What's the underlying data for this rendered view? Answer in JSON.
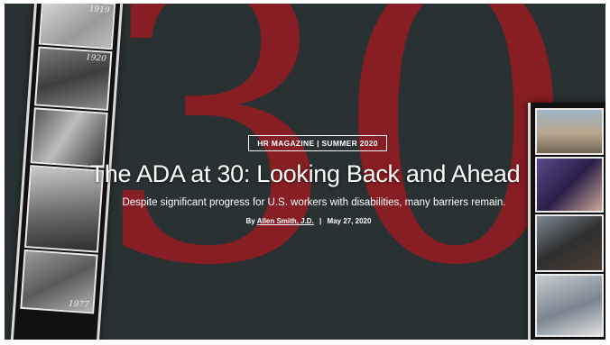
{
  "hero": {
    "background_color": "#2a3133",
    "number_color": "#8f1d22",
    "big_number": "30",
    "badge": "HR MAGAZINE | SUMMER 2020",
    "title": "The ADA at 30: Looking Back and Ahead",
    "subtitle": "Despite significant progress for U.S. workers with disabilities, many barriers remain.",
    "byline": {
      "prefix": "By",
      "author": "Allen Smith, J.D.",
      "separator": "|",
      "date": "May 27, 2020"
    }
  },
  "filmstrip_left": {
    "years": [
      "1919",
      "1920",
      "",
      "",
      "1977"
    ]
  }
}
